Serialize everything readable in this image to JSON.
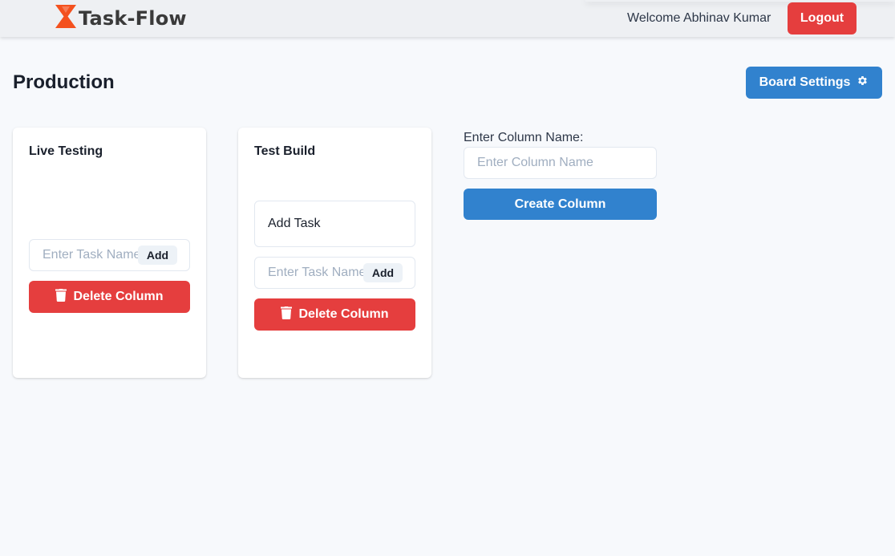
{
  "app": {
    "name": "Task-Flow",
    "welcome_text": "Welcome Abhinav Kumar",
    "logout_label": "Logout",
    "accent_color": "#3182ce",
    "danger_color": "#e53e3e",
    "logo_color": "#f4511e"
  },
  "board": {
    "title": "Production",
    "settings_label": "Board Settings",
    "settings_icon": "gear-icon"
  },
  "columns": [
    {
      "title": "Live Testing",
      "tasks": [],
      "task_placeholder": "Enter Task Name",
      "add_label": "Add",
      "delete_label": "Delete Column",
      "delete_icon": "trash-icon"
    },
    {
      "title": "Test Build",
      "tasks": [
        "Add Task"
      ],
      "task_placeholder": "Enter Task Name",
      "add_label": "Add",
      "delete_label": "Delete Column",
      "delete_icon": "trash-icon"
    }
  ],
  "new_column": {
    "label": "Enter Column Name:",
    "placeholder": "Enter Column Name",
    "value": "",
    "create_label": "Create Column"
  }
}
